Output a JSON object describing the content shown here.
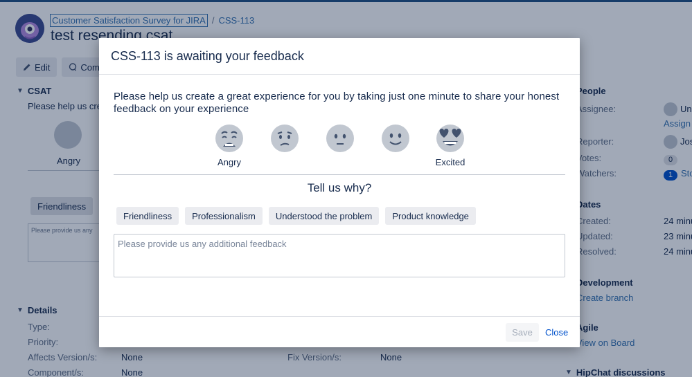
{
  "breadcrumb": {
    "project": "Customer Satisfaction Survey for JIRA",
    "separator": "/",
    "issue_key": "CSS-113"
  },
  "issue": {
    "title": "test resending csat"
  },
  "toolbar": {
    "edit_label": "Edit",
    "comment_label": "Com"
  },
  "csat_section": {
    "heading": "CSAT",
    "text": "Please help us cre",
    "angry_label": "Angry",
    "chip": "Friendliness",
    "textarea_text": "Please provide us any"
  },
  "details": {
    "heading": "Details",
    "type_label": "Type:",
    "priority_label": "Priority:",
    "affects_label": "Affects Version/s:",
    "affects_value": "None",
    "component_label": "Component/s:",
    "component_value": "None",
    "fix_label": "Fix Version/s:",
    "fix_value": "None"
  },
  "people": {
    "heading": "People",
    "assignee_label": "Assignee:",
    "assignee_value": "Un",
    "assign_link": "Assign",
    "reporter_label": "Reporter:",
    "reporter_value": "Jos",
    "votes_label": "Votes:",
    "votes_count": "0",
    "watchers_label": "Watchers:",
    "watchers_count": "1",
    "watchers_link": "Sto"
  },
  "dates": {
    "heading": "Dates",
    "created_label": "Created:",
    "created_value": "24 minu",
    "updated_label": "Updated:",
    "updated_value": "23 minu",
    "resolved_label": "Resolved:",
    "resolved_value": "24 minu"
  },
  "development": {
    "heading": "Development",
    "link": "Create branch"
  },
  "agile": {
    "heading": "Agile",
    "link": "View on Board"
  },
  "hipchat": {
    "heading": "HipChat discussions"
  },
  "modal": {
    "title": "CSS-113 is awaiting your feedback",
    "prompt": "Please help us create a great experience for you by taking just one minute to share your honest feedback on your experience",
    "faces": [
      {
        "icon": "angry-face-icon",
        "label": "Angry"
      },
      {
        "icon": "frowning-face-icon",
        "label": ""
      },
      {
        "icon": "neutral-face-icon",
        "label": ""
      },
      {
        "icon": "smiling-face-icon",
        "label": ""
      },
      {
        "icon": "heart-eyes-face-icon",
        "label": "Excited"
      }
    ],
    "why_heading": "Tell us why?",
    "chips": [
      "Friendliness",
      "Professionalism",
      "Understood the problem",
      "Product knowledge"
    ],
    "feedback_placeholder": "Please provide us any additional feedback",
    "save_label": "Save",
    "close_label": "Close"
  },
  "colors": {
    "link": "#3572b0",
    "header_bar": "#205081",
    "emoji_yellow": "#f5c84c"
  }
}
